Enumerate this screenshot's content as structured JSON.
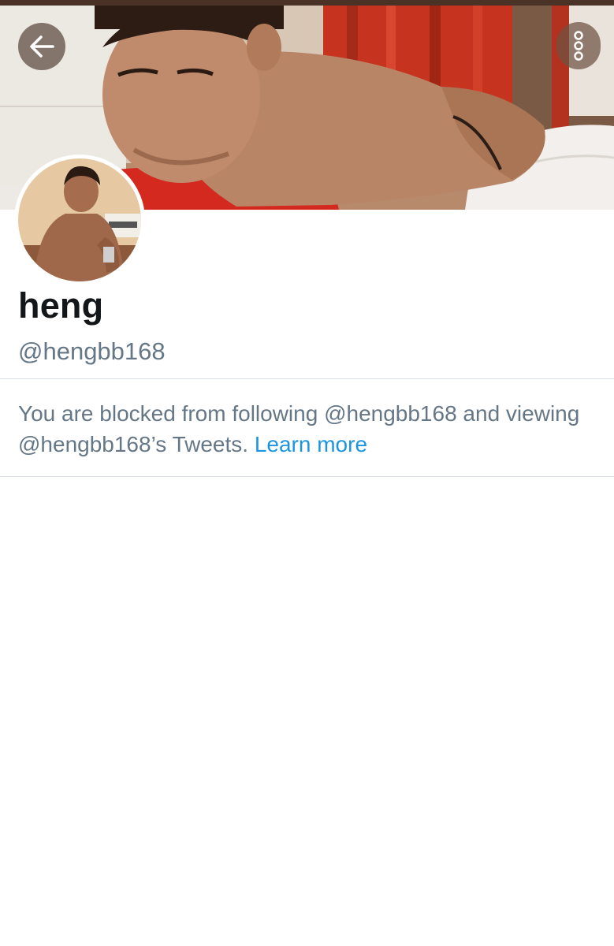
{
  "profile": {
    "display_name": "heng",
    "handle": "@hengbb168"
  },
  "notice": {
    "text": "You are blocked from following @hengbb168 and viewing @hengbb168’s Tweets.",
    "link_label": "Learn more"
  },
  "icons": {
    "back": "arrow-left-icon",
    "more": "more-vertical-icon"
  },
  "colors": {
    "link": "#1b95e0",
    "secondary_text": "#657786",
    "primary_text": "#14171a",
    "divider": "#d9dfe4"
  }
}
